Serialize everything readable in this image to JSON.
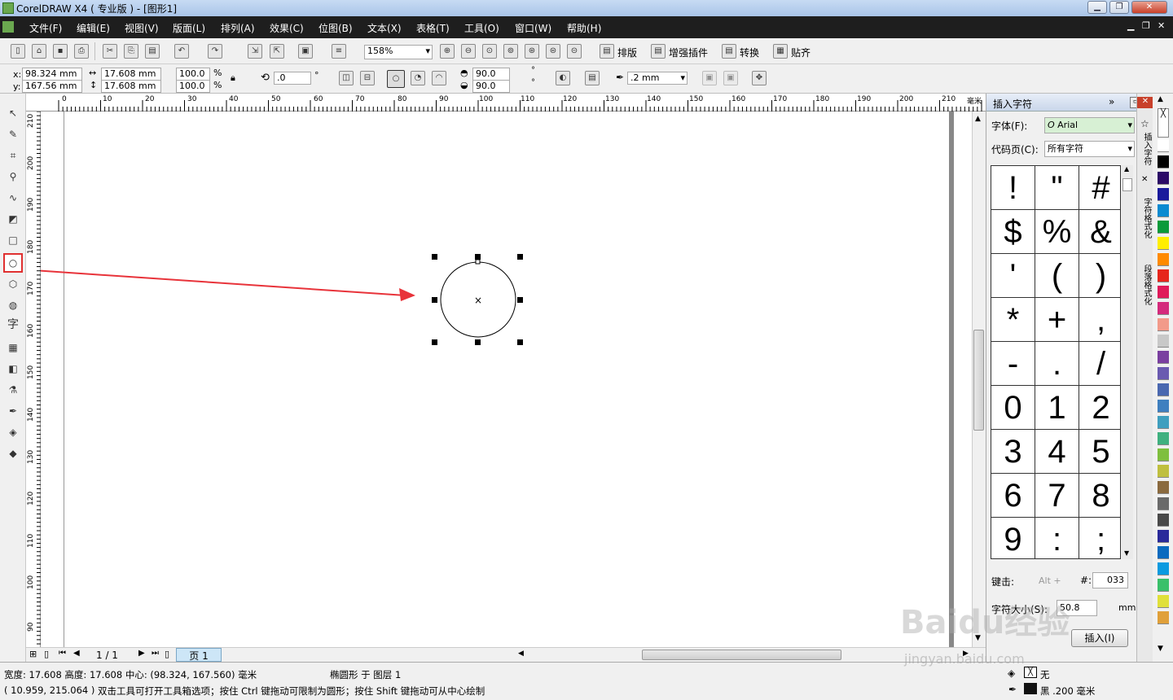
{
  "titlebar": {
    "title": "CorelDRAW X4 ( 专业版 ) - [图形1]"
  },
  "menu": [
    "文件(F)",
    "编辑(E)",
    "视图(V)",
    "版面(L)",
    "排列(A)",
    "效果(C)",
    "位图(B)",
    "文本(X)",
    "表格(T)",
    "工具(O)",
    "窗口(W)",
    "帮助(H)"
  ],
  "toolbar": {
    "zoom": "158%",
    "plugins": [
      "排版",
      "增强插件",
      "转换",
      "贴齐"
    ]
  },
  "property_bar": {
    "x": "98.324 mm",
    "y": "167.56 mm",
    "width": "17.608 mm",
    "height": "17.608 mm",
    "scale_x": "100.0",
    "scale_y": "100.0",
    "percent": "%",
    "rotation": ".0",
    "degree": "°",
    "start_angle": "90.0",
    "end_angle": "90.0",
    "outline_width": ".2 mm"
  },
  "ruler": {
    "h": [
      "0",
      "10",
      "20",
      "30",
      "40",
      "50",
      "60",
      "70",
      "80",
      "90",
      "100",
      "110",
      "120",
      "130",
      "140",
      "150",
      "160",
      "170",
      "180",
      "190",
      "200",
      "210"
    ],
    "unit": "毫米",
    "v": [
      "210",
      "200",
      "190",
      "180",
      "170",
      "160",
      "150",
      "140",
      "130",
      "120",
      "110",
      "100",
      "90"
    ]
  },
  "page_nav": {
    "count": "1 / 1",
    "tab": "页 1"
  },
  "docker": {
    "title": "插入字符",
    "font_label": "字体(F):",
    "font_value": "Arial",
    "codepage_label": "代码页(C):",
    "codepage_value": "所有字符",
    "chars": [
      "!",
      "\"",
      "#",
      "$",
      "%",
      "&",
      "'",
      "(",
      ")",
      "*",
      "+",
      ",",
      "-",
      ".",
      "/",
      "0",
      "1",
      "2",
      "3",
      "4",
      "5",
      "6",
      "7",
      "8",
      "9",
      ":",
      ";"
    ],
    "key_label": "键击:",
    "alt_label": "Alt +",
    "hash_label": "#:",
    "code_value": "033",
    "size_label": "字符大小(S):",
    "size_value": "50.8",
    "size_unit": "mm",
    "insert_label": "插入(I)"
  },
  "docker_tabs": [
    "插入字符",
    "字符格式化",
    "段落格式化"
  ],
  "status": {
    "line1": "宽度: 17.608  高度: 17.608  中心: (98.324, 167.560)  毫米",
    "layer": "椭圆形 于 图层 1",
    "line2": "( 10.959, 215.064 )",
    "hint": "双击工具可打开工具箱选项；按住 Ctrl 键拖动可限制为圆形；按住 Shift 键拖动可从中心绘制",
    "fill": "无",
    "outline": "黑 .200 毫米"
  },
  "watermark": {
    "logo": "Baidu经验",
    "url": "jingyan.baidu.com"
  },
  "colors": {
    "palette": [
      "#ffffff",
      "#000000",
      "#2b0a66",
      "#1a1a9c",
      "#0a8ad1",
      "#0a9a3a",
      "#ffee00",
      "#ff8a00",
      "#e6261c",
      "#e01a5a",
      "#d42a7c",
      "#f29a8a",
      "#c8c8c8",
      "#7a3fa0",
      "#6a5ab0",
      "#4a68b0",
      "#3f7fbf",
      "#3f9fbf",
      "#3fb07f",
      "#7fbf3f",
      "#bfbf3f",
      "#8a6a3f",
      "#6a6a6a",
      "#4a4a4a",
      "#2a2a9a",
      "#0a6abf",
      "#0a9ae0",
      "#3ac06a",
      "#e0e03a",
      "#e0a03a"
    ]
  }
}
